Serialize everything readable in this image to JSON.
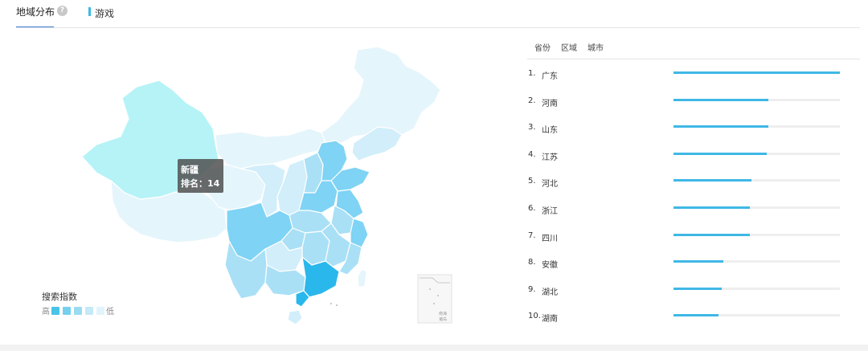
{
  "header": {
    "active_tab": "地域分布",
    "help_icon": "question-icon",
    "game_tab": "游戏"
  },
  "map": {
    "tooltip": {
      "name": "新疆",
      "rank_label": "排名：14"
    },
    "legend": {
      "title": "搜索指数",
      "high": "高",
      "low": "低",
      "colors": [
        "#49c3e8",
        "#74d0ee",
        "#9adbf2",
        "#c4e9f8",
        "#e2f4fb"
      ]
    },
    "inset_lines": [
      "南海",
      "诸岛"
    ],
    "region_colors": {
      "highlight": "#2ab7ec",
      "dark": "#7fd3f4",
      "mid": "#a9e0f6",
      "light": "#d1eefa",
      "lightest": "#e5f5fc",
      "xinjiang": "#b5f3f7"
    }
  },
  "panel": {
    "sub_tabs": [
      "省份",
      "区域",
      "城市"
    ],
    "rows": [
      {
        "rank": "1.",
        "name": "广东",
        "value": 1.0
      },
      {
        "rank": "2.",
        "name": "河南",
        "value": 0.57
      },
      {
        "rank": "3.",
        "name": "山东",
        "value": 0.57
      },
      {
        "rank": "4.",
        "name": "江苏",
        "value": 0.56
      },
      {
        "rank": "5.",
        "name": "河北",
        "value": 0.47
      },
      {
        "rank": "6.",
        "name": "浙江",
        "value": 0.46
      },
      {
        "rank": "7.",
        "name": "四川",
        "value": 0.46
      },
      {
        "rank": "8.",
        "name": "安徽",
        "value": 0.3
      },
      {
        "rank": "9.",
        "name": "湖北",
        "value": 0.29
      },
      {
        "rank": "10.",
        "name": "湖南",
        "value": 0.27
      }
    ],
    "bar_color": "#3fb8e6",
    "track_color": "#eeeeee"
  }
}
